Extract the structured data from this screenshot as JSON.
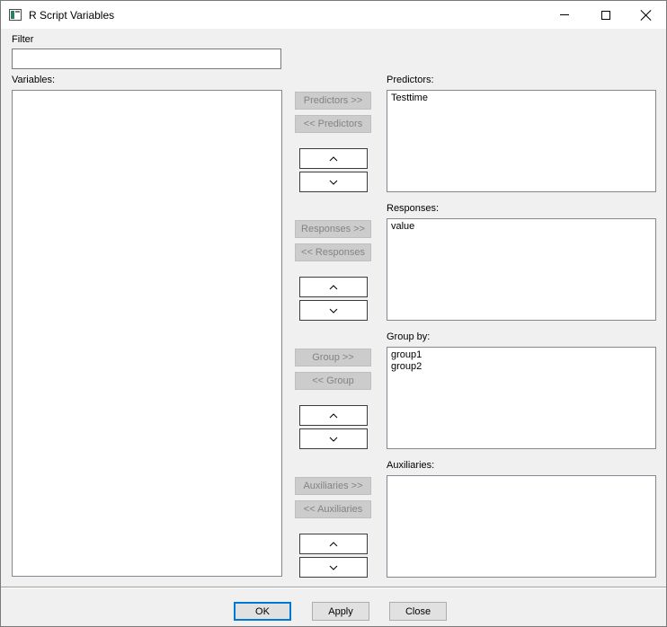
{
  "window": {
    "title": "R Script Variables",
    "icon": "app-window-icon"
  },
  "filter": {
    "label": "Filter",
    "value": ""
  },
  "variables": {
    "label": "Variables:",
    "items": []
  },
  "predictors": {
    "label": "Predictors:",
    "add_label": "Predictors >>",
    "remove_label": "<< Predictors",
    "items": [
      "Testtime"
    ]
  },
  "responses": {
    "label": "Responses:",
    "add_label": "Responses >>",
    "remove_label": "<< Responses",
    "items": [
      "value"
    ]
  },
  "group_by": {
    "label": "Group by:",
    "add_label": "Group >>",
    "remove_label": "<< Group",
    "items": [
      "group1",
      "group2"
    ]
  },
  "auxiliaries": {
    "label": "Auxiliaries:",
    "add_label": "Auxiliaries >>",
    "remove_label": "<< Auxiliaries",
    "items": []
  },
  "buttons": {
    "ok": "OK",
    "apply": "Apply",
    "close": "Close"
  }
}
